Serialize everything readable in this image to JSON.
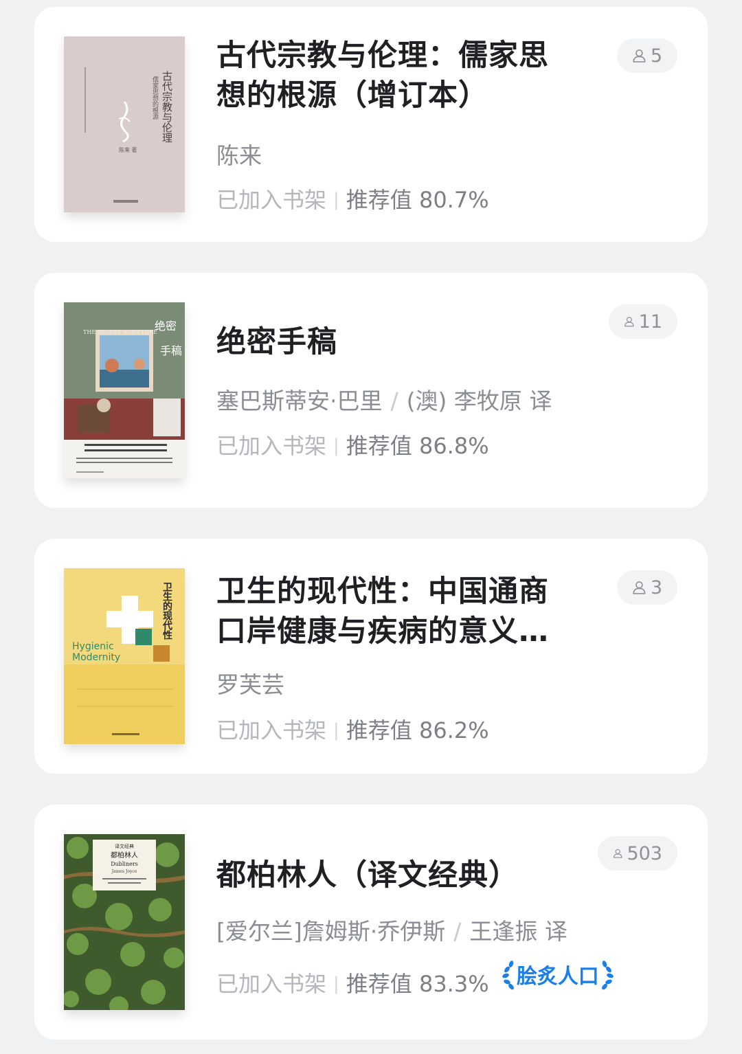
{
  "books": [
    {
      "title": "古代宗教与伦理：儒家思想的根源（增订本）",
      "author": "陈来",
      "translator": "",
      "status": "已加入书架",
      "recommend": "推荐值 80.7%",
      "readers": "5",
      "award": ""
    },
    {
      "title": "绝密手稿",
      "author": "塞巴斯蒂安·巴里",
      "translator": "(澳) 李牧原 译",
      "status": "已加入书架",
      "recommend": "推荐值 86.8%",
      "readers": "11",
      "award": ""
    },
    {
      "title": "卫生的现代性：中国通商口岸健康与疾病的意义…",
      "author": "罗芙芸",
      "translator": "",
      "status": "已加入书架",
      "recommend": "推荐值 86.2%",
      "readers": "3",
      "award": ""
    },
    {
      "title": "都柏林人（译文经典）",
      "author": "[爱尔兰]詹姆斯·乔伊斯",
      "translator": "王逢振 译",
      "status": "已加入书架",
      "recommend": "推荐值 83.3%",
      "readers": "503",
      "award": "脍炙人口"
    }
  ],
  "covers": [
    {
      "title_vertical": "古代宗教与伦理",
      "subtitle_vertical": "儒家思想的根源",
      "author": "陈来 著",
      "bg": "#d9cccc"
    },
    {
      "title_vertical": "绝密",
      "title_vertical2": "手稿",
      "en_title": "THE SECRET SCRIPTURE",
      "bg": "#6a7a8c"
    },
    {
      "title_vertical": "卫生的现代性",
      "en_title": "Hygienic",
      "en_title2": "Modernity",
      "bg": "#f4d97c"
    },
    {
      "series": "译文经典",
      "title_zh": "都柏林人",
      "en_title": "Dubliners",
      "author": "James Joyce",
      "bg": "#4d6a35"
    }
  ],
  "colors": {
    "accent_award": "#1b7fe8",
    "background": "#f0f1f3",
    "card": "#ffffff"
  },
  "icons": {
    "readers": "person-icon",
    "award": "laurel-icon"
  }
}
